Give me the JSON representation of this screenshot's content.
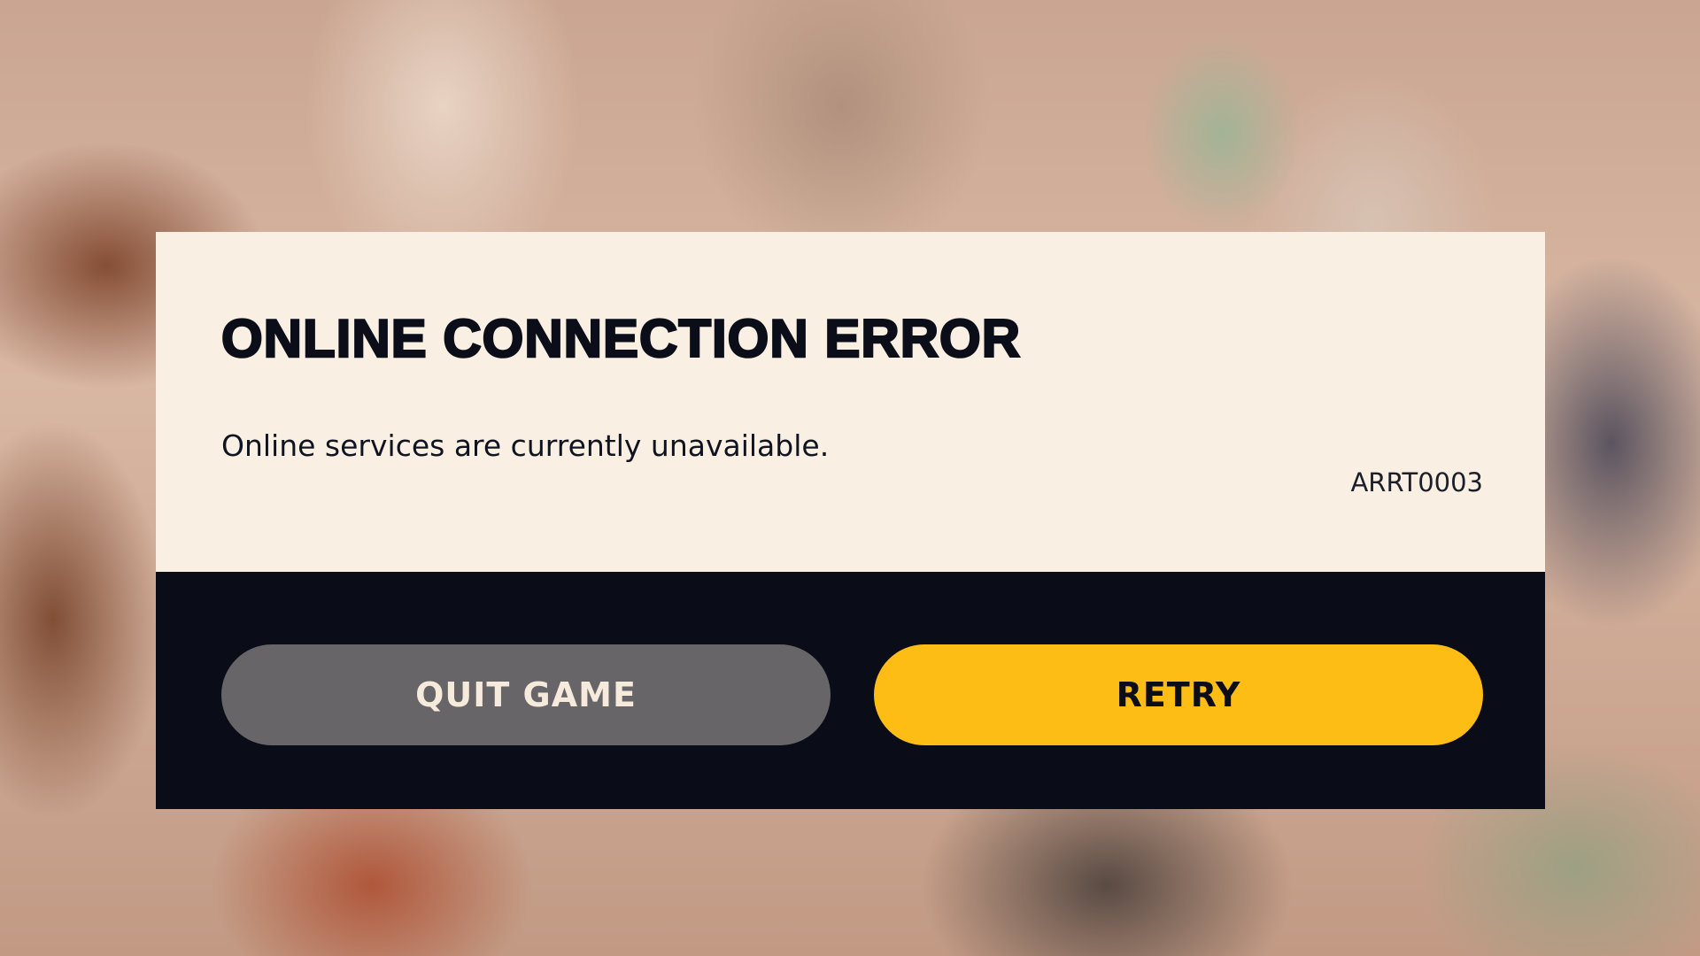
{
  "dialog": {
    "title": "ONLINE CONNECTION ERROR",
    "message": "Online services are currently unavailable.",
    "error_code": "ARRT0003"
  },
  "buttons": {
    "quit_label": "QUIT GAME",
    "retry_label": "RETRY"
  },
  "colors": {
    "panel_light": "#faefe3",
    "panel_dark": "#0a0d18",
    "quit_button": "#676567",
    "retry_button": "#fdbd15",
    "text_dark": "#0b0e18"
  }
}
